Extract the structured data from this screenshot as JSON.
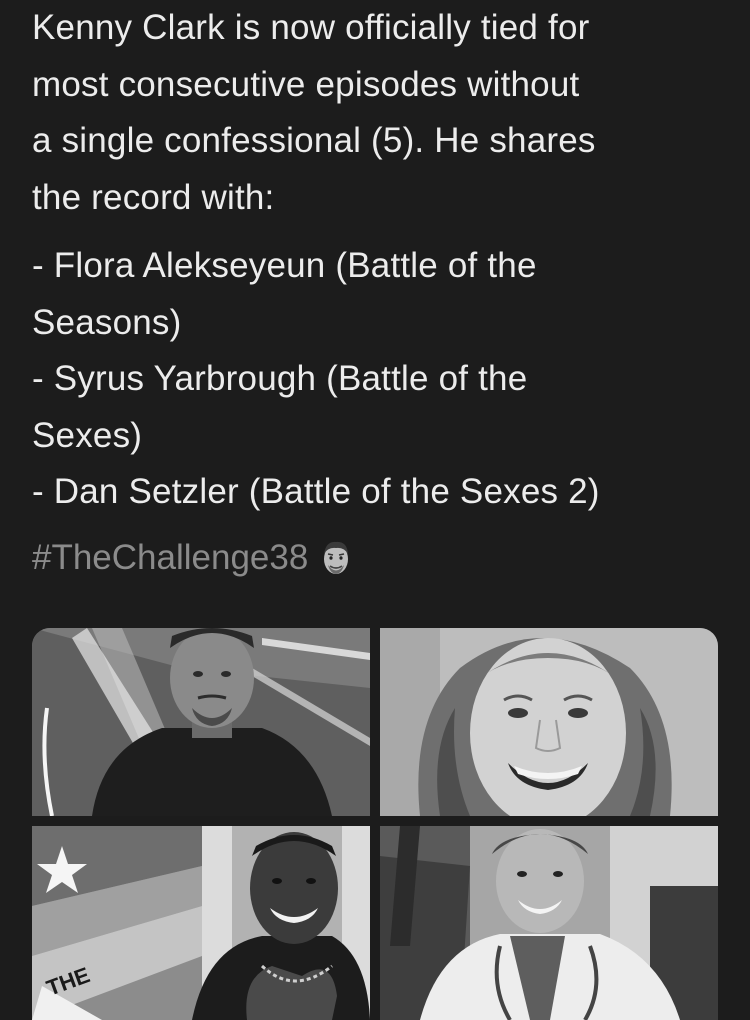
{
  "tweet": {
    "paragraph": [
      "Kenny Clark is now officially tied for",
      "most consecutive episodes without",
      "a single confessional (5). He shares",
      "the record with:"
    ],
    "list": [
      "- Flora Alekseyeun (Battle of the",
      "Seasons)",
      "- Syrus Yarbrough (Battle of the",
      "Sexes)",
      "- Dan Setzler (Battle of the Sexes 2)"
    ],
    "hashtag": "#TheChallenge38",
    "hashtag_emoji": "man-face-emoji-icon"
  },
  "media": {
    "photos": [
      {
        "name": "kenny-clark-photo"
      },
      {
        "name": "flora-photo"
      },
      {
        "name": "syrus-photo"
      },
      {
        "name": "dan-photo"
      }
    ]
  },
  "colors": {
    "background": "#1c1c1c",
    "text": "#ececec",
    "hashtag": "#8b8b8b"
  }
}
